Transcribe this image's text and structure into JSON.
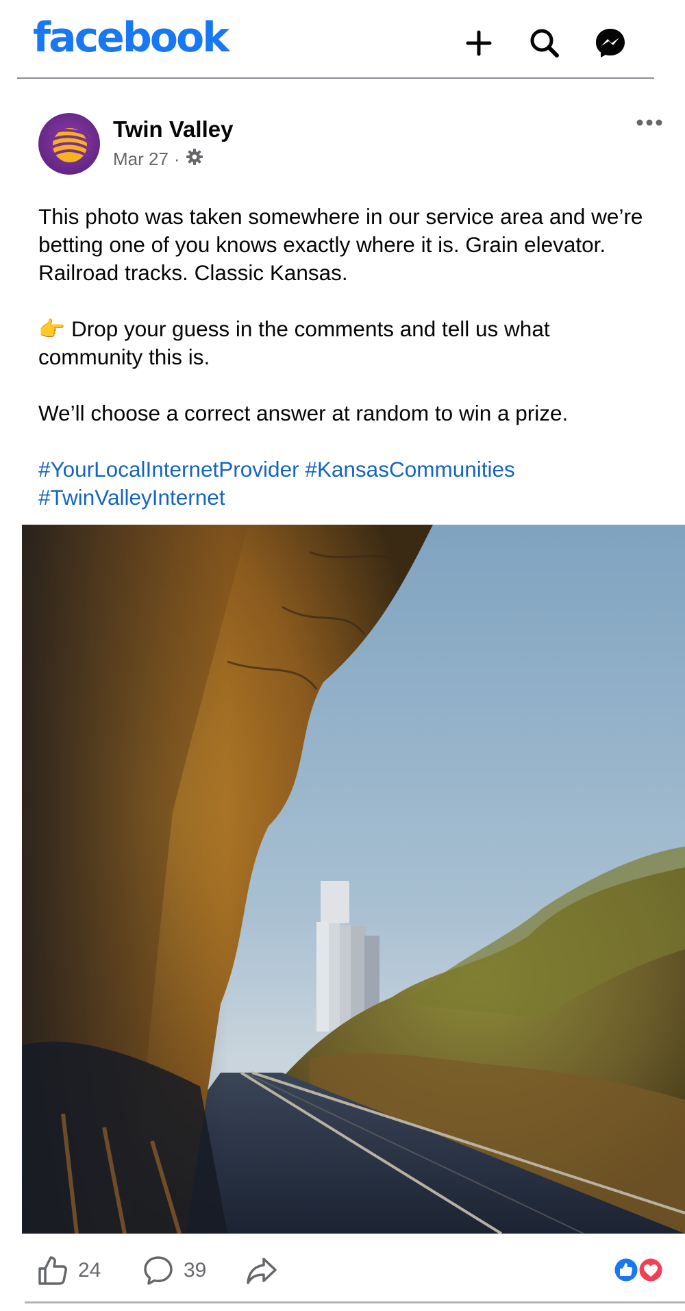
{
  "app": {
    "logo_text": "facebook",
    "brand_color": "#1877f2"
  },
  "header": {
    "icons": [
      "plus-icon",
      "search-icon",
      "messenger-icon"
    ]
  },
  "post": {
    "author": "Twin Valley",
    "date": "Mar 27",
    "separator": "·",
    "audience_icon": "gear-icon",
    "paragraphs": [
      "This photo was taken somewhere in our service area and we’re betting one of you knows exactly where it is. Grain elevator. Railroad tracks. Classic Kansas.",
      "Drop your guess in the comments and tell us what community this is.",
      "We’ll choose a correct answer at random to win a prize."
    ],
    "pointing_emoji": "👉",
    "hashtags": [
      "#YourLocalInternetProvider",
      "#KansasCommunities",
      "#TwinValleyInternet"
    ],
    "link_color": "#1565c0"
  },
  "photo": {
    "subject": "railroad-tracks-grain-elevator-photo"
  },
  "footer": {
    "like_count": "24",
    "comment_count": "39",
    "share_icon": "share-icon",
    "reaction_icons": [
      "like-reaction-icon",
      "love-reaction-icon"
    ]
  }
}
